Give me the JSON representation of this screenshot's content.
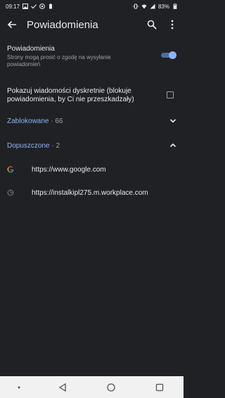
{
  "status_bar": {
    "time": "09:17",
    "battery": "83%"
  },
  "app_bar": {
    "title": "Powiadomienia",
    "back_icon": "arrow-back-icon",
    "search_icon": "search-icon",
    "more_icon": "more-vert-icon"
  },
  "notifications_setting": {
    "label": "Powiadomienia",
    "sublabel": "Strony mogą prosić o zgodę na wysyłanie powiadomień",
    "enabled": true
  },
  "quiet_setting": {
    "label": "Pokazuj wiadomości dyskretnie (blokuje powiadomienia, by Ci nie przeszkadzały)",
    "checked": false
  },
  "blocked_section": {
    "label": "Zablokowane",
    "count": "· 66",
    "expanded": false
  },
  "allowed_section": {
    "label": "Dopuszczone",
    "count": "· 2",
    "expanded": true,
    "sites": [
      {
        "url": "https://www.google.com",
        "icon": "google-favicon-icon"
      },
      {
        "url": "https://instalkipl275.m.workplace.com",
        "icon": "globe-icon"
      }
    ]
  },
  "colors": {
    "background": "#202124",
    "accent": "#8ab4f8",
    "text_primary": "#e8eaed",
    "text_secondary": "#9aa0a6",
    "nav_bar": "#f1f1f1"
  }
}
